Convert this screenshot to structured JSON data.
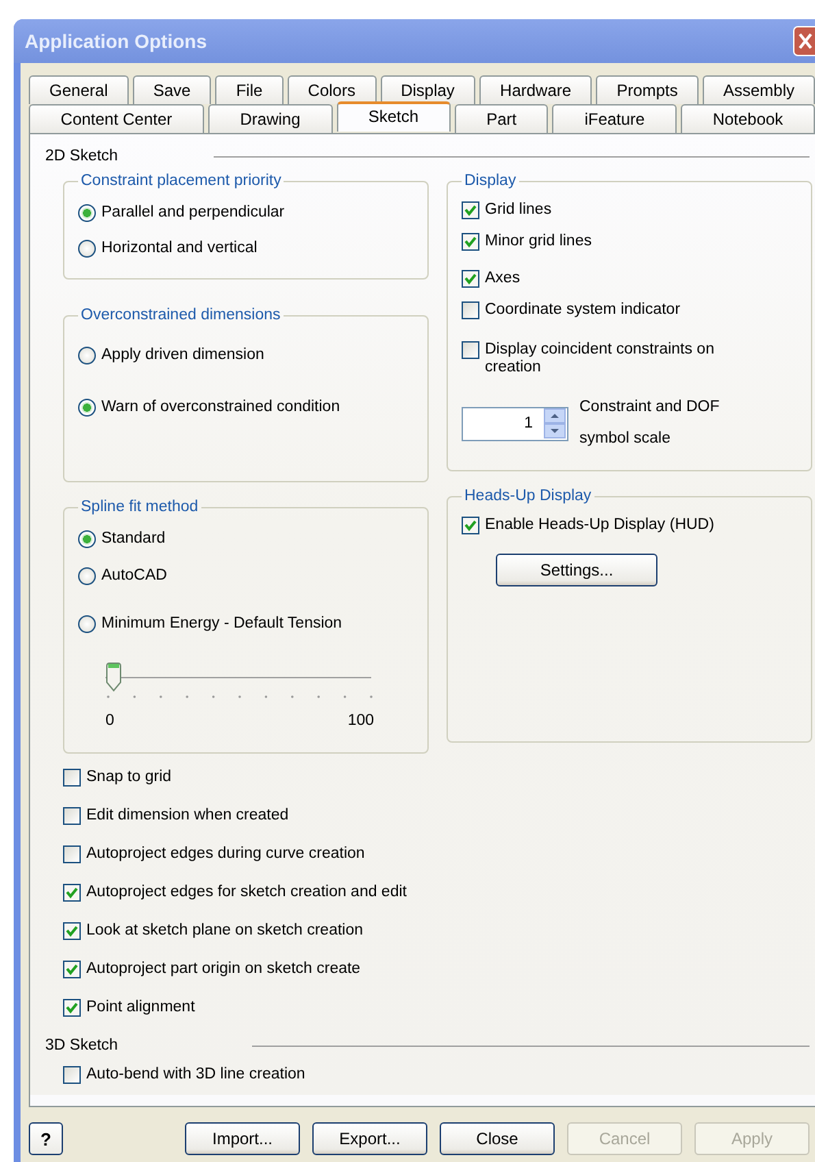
{
  "window": {
    "title": "Application Options"
  },
  "tab_rows": [
    [
      {
        "label": "General",
        "selected": false
      },
      {
        "label": "Save",
        "selected": false
      },
      {
        "label": "File",
        "selected": false
      },
      {
        "label": "Colors",
        "selected": false
      },
      {
        "label": "Display",
        "selected": false
      },
      {
        "label": "Hardware",
        "selected": false
      },
      {
        "label": "Prompts",
        "selected": false
      },
      {
        "label": "Assembly",
        "selected": false
      }
    ],
    [
      {
        "label": "Content Center",
        "selected": false
      },
      {
        "label": "Drawing",
        "selected": false
      },
      {
        "label": "Sketch",
        "selected": true
      },
      {
        "label": "Part",
        "selected": false
      },
      {
        "label": "iFeature",
        "selected": false
      },
      {
        "label": "Notebook",
        "selected": false
      }
    ]
  ],
  "sketch_2d": {
    "title": "2D Sketch",
    "left_groups": [
      {
        "title": "Constraint placement priority",
        "options": [
          {
            "label": "Parallel and perpendicular",
            "selected": true
          },
          {
            "label": "Horizontal and vertical",
            "selected": false
          }
        ]
      },
      {
        "title": "Overconstrained dimensions",
        "options": [
          {
            "label": "Apply driven dimension",
            "selected": false
          },
          {
            "label": "Warn of overconstrained condition",
            "selected": true
          }
        ]
      },
      {
        "title": "Spline fit method",
        "options": [
          {
            "label": "Standard",
            "selected": true
          },
          {
            "label": "AutoCAD",
            "selected": false
          },
          {
            "label": "Minimum Energy - Default Tension",
            "selected": false
          }
        ],
        "slider": {
          "level": 0,
          "min_label": "0",
          "max_label": "100"
        }
      }
    ],
    "right_groups": [
      {
        "title": "Display",
        "items": [
          {
            "kind": "checkbox",
            "label": "Grid lines",
            "checked": true
          },
          {
            "kind": "checkbox",
            "label": "Minor grid lines",
            "checked": true
          },
          {
            "kind": "checkbox",
            "label": "Axes",
            "checked": true
          },
          {
            "kind": "checkbox",
            "label": "Coordinate system indicator",
            "checked": false
          },
          {
            "kind": "checkbox",
            "label": "Display coincident constraints on creation",
            "checked": false
          },
          {
            "kind": "spinner",
            "value": "1",
            "label": "Constraint and DOF symbol scale"
          }
        ]
      },
      {
        "title": "Heads-Up Display",
        "items": [
          {
            "kind": "checkbox",
            "label": "Enable Heads-Up Display (HUD)",
            "checked": true
          },
          {
            "kind": "button",
            "label": "Settings..."
          }
        ]
      }
    ],
    "options": [
      {
        "label": "Snap to grid",
        "checked": false
      },
      {
        "label": "Edit dimension when created",
        "checked": false
      },
      {
        "label": "Autoproject edges during curve creation",
        "checked": false
      },
      {
        "label": "Autoproject edges for sketch creation and edit",
        "checked": true
      },
      {
        "label": "Look at sketch plane on sketch creation",
        "checked": true
      },
      {
        "label": "Autoproject part origin on sketch create",
        "checked": true
      },
      {
        "label": "Point alignment",
        "checked": true
      }
    ]
  },
  "sketch_3d": {
    "title": "3D Sketch",
    "options": [
      {
        "label": "Auto-bend with 3D line creation",
        "checked": false
      }
    ]
  },
  "help_button": "?",
  "buttons": [
    {
      "label": "Import...",
      "disabled": false
    },
    {
      "label": "Export...",
      "disabled": false
    },
    {
      "label": "Close",
      "disabled": false
    },
    {
      "label": "Cancel",
      "disabled": true
    },
    {
      "label": "Apply",
      "disabled": true
    }
  ]
}
